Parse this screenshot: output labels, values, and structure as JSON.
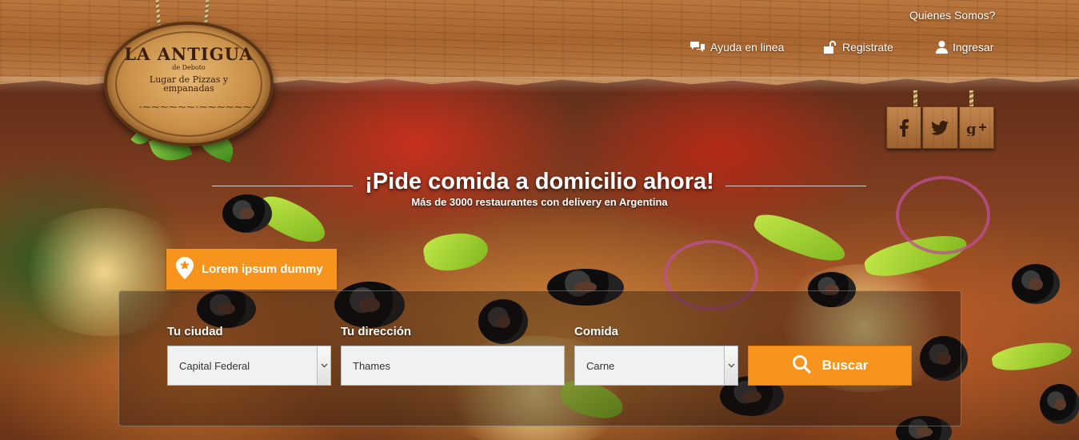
{
  "header": {
    "links": {
      "about": "Quienes Somos?",
      "help": "Ayuda en linea",
      "register": "Registrate",
      "login": "Ingresar"
    }
  },
  "logo": {
    "title": "LA ANTIGUA",
    "subtitle": "de Deboto",
    "tagline": "Lugar de Pizzas y empanadas"
  },
  "social": [
    "facebook-icon",
    "twitter-icon",
    "google-plus-icon"
  ],
  "hero": {
    "headline": "¡Pide comida a domicilio ahora!",
    "subheadline": "Más de 3000 restaurantes con delivery en Argentina"
  },
  "tab": {
    "label": "Lorem ipsum dummy"
  },
  "search": {
    "city_label": "Tu ciudad",
    "city_value": "Capital Federal",
    "address_label": "Tu dirección",
    "address_value": "Thames",
    "food_label": "Comida",
    "food_value": "Carne",
    "button_label": "Buscar"
  },
  "colors": {
    "accent": "#f7941d",
    "wood": "#b8753c"
  }
}
